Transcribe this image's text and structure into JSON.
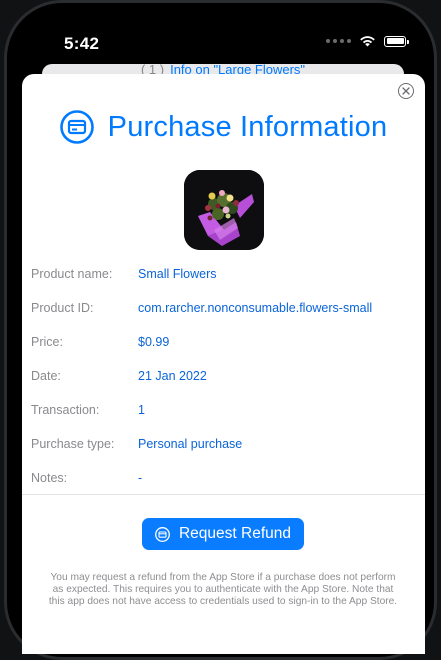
{
  "status_bar": {
    "time": "5:42"
  },
  "background_sheet": {
    "bracket": "( 1 )",
    "title": "Info on \"Large Flowers\""
  },
  "sheet": {
    "title": "Purchase Information",
    "details": [
      {
        "label": "Product name:",
        "value": "Small Flowers"
      },
      {
        "label": "Product ID:",
        "value": "com.rarcher.nonconsumable.flowers-small"
      },
      {
        "label": "Price:",
        "value": "$0.99"
      },
      {
        "label": "Date:",
        "value": "21 Jan 2022"
      },
      {
        "label": "Transaction:",
        "value": "1"
      },
      {
        "label": "Purchase type:",
        "value": "Personal purchase"
      },
      {
        "label": "Notes:",
        "value": "-"
      }
    ],
    "refund_button_label": "Request Refund",
    "footnote": "You may request a refund from the App Store if a purchase does not perform as expected. This requires you to authenticate with the App Store. Note that this app does not have access to credentials used to sign-in to the App Store."
  },
  "colors": {
    "accent": "#007aff",
    "label_gray": "#8a8a8e",
    "button_blue": "#0a7cff"
  },
  "icons": [
    "wifi-icon",
    "battery-icon",
    "close-icon",
    "credit-card-icon",
    "flowers-product-image"
  ]
}
